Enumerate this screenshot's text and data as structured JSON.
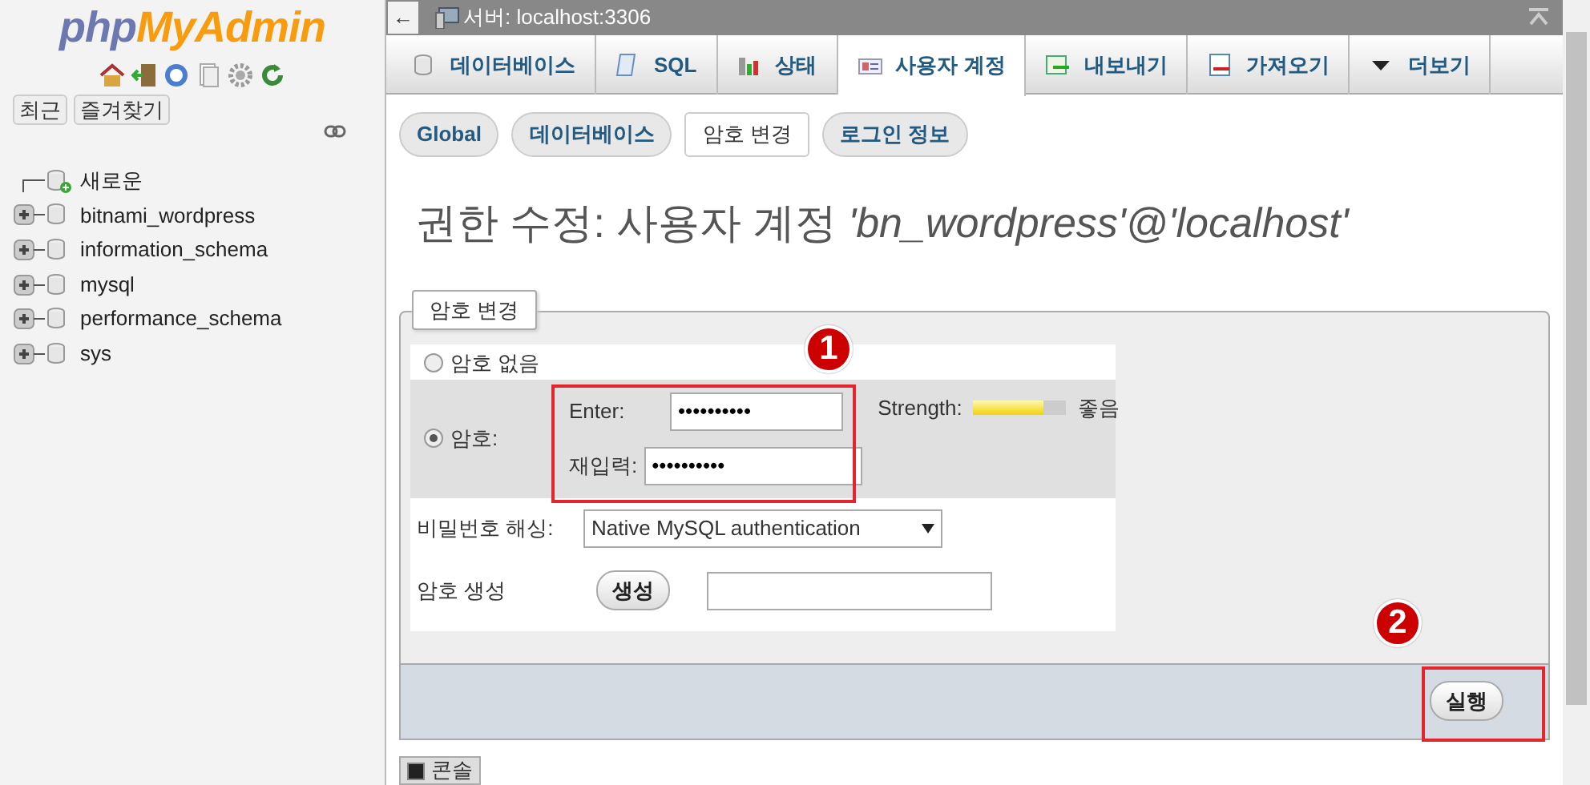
{
  "sidebar": {
    "logo": {
      "part_1": "php",
      "part_2": "MyAdmin"
    },
    "buttons": [
      "최근",
      "즐겨찾기"
    ],
    "tree": [
      {
        "label": "새로운",
        "kind": "new"
      },
      {
        "label": "bitnami_wordpress",
        "kind": "db",
        "expanded": false
      },
      {
        "label": "information_schema",
        "kind": "db",
        "expanded": false
      },
      {
        "label": "mysql",
        "kind": "db",
        "expanded": false
      },
      {
        "label": "performance_schema",
        "kind": "db",
        "expanded": false
      },
      {
        "label": "sys",
        "kind": "db",
        "expanded": false
      }
    ]
  },
  "breadcrumb": {
    "back": "←",
    "server": "서버: localhost:3306"
  },
  "tabs": [
    {
      "label": "데이터베이스",
      "selected": false
    },
    {
      "label": "SQL",
      "selected": false
    },
    {
      "label": "상태",
      "selected": false
    },
    {
      "label": "사용자 계정",
      "selected": true
    },
    {
      "label": "내보내기",
      "selected": false
    },
    {
      "label": "가져오기",
      "selected": false
    },
    {
      "label": "더보기",
      "selected": false
    }
  ],
  "subtabs": [
    {
      "label": "Global",
      "selected": false
    },
    {
      "label": "데이터베이스",
      "selected": false
    },
    {
      "label": "암호 변경",
      "selected": true
    },
    {
      "label": "로그인 정보",
      "selected": false
    }
  ],
  "heading": "권한 수정: 사용자 계정 *'bn_wordpress'@'localhost'*",
  "form": {
    "legend": "암호 변경",
    "options": [
      {
        "label": "암호 없음",
        "selected": false
      },
      {
        "label": "암호:",
        "selected": true
      }
    ],
    "enter_label": "Enter:",
    "enter_value": "••••••••••",
    "reenter_label": "재입력:",
    "reenter_value": "••••••••••",
    "strength_label": "Strength:",
    "strength": {
      "level": 0.75
    },
    "strength_reading": "좋음",
    "hashing_label": "비밀번호 해싱:",
    "hashing_value": "Native MySQL authentication",
    "generate_label": "암호 생성",
    "generate_button": "생성",
    "submit": "실행"
  },
  "annotations": [
    "1",
    "2"
  ],
  "console": "콘솔"
}
